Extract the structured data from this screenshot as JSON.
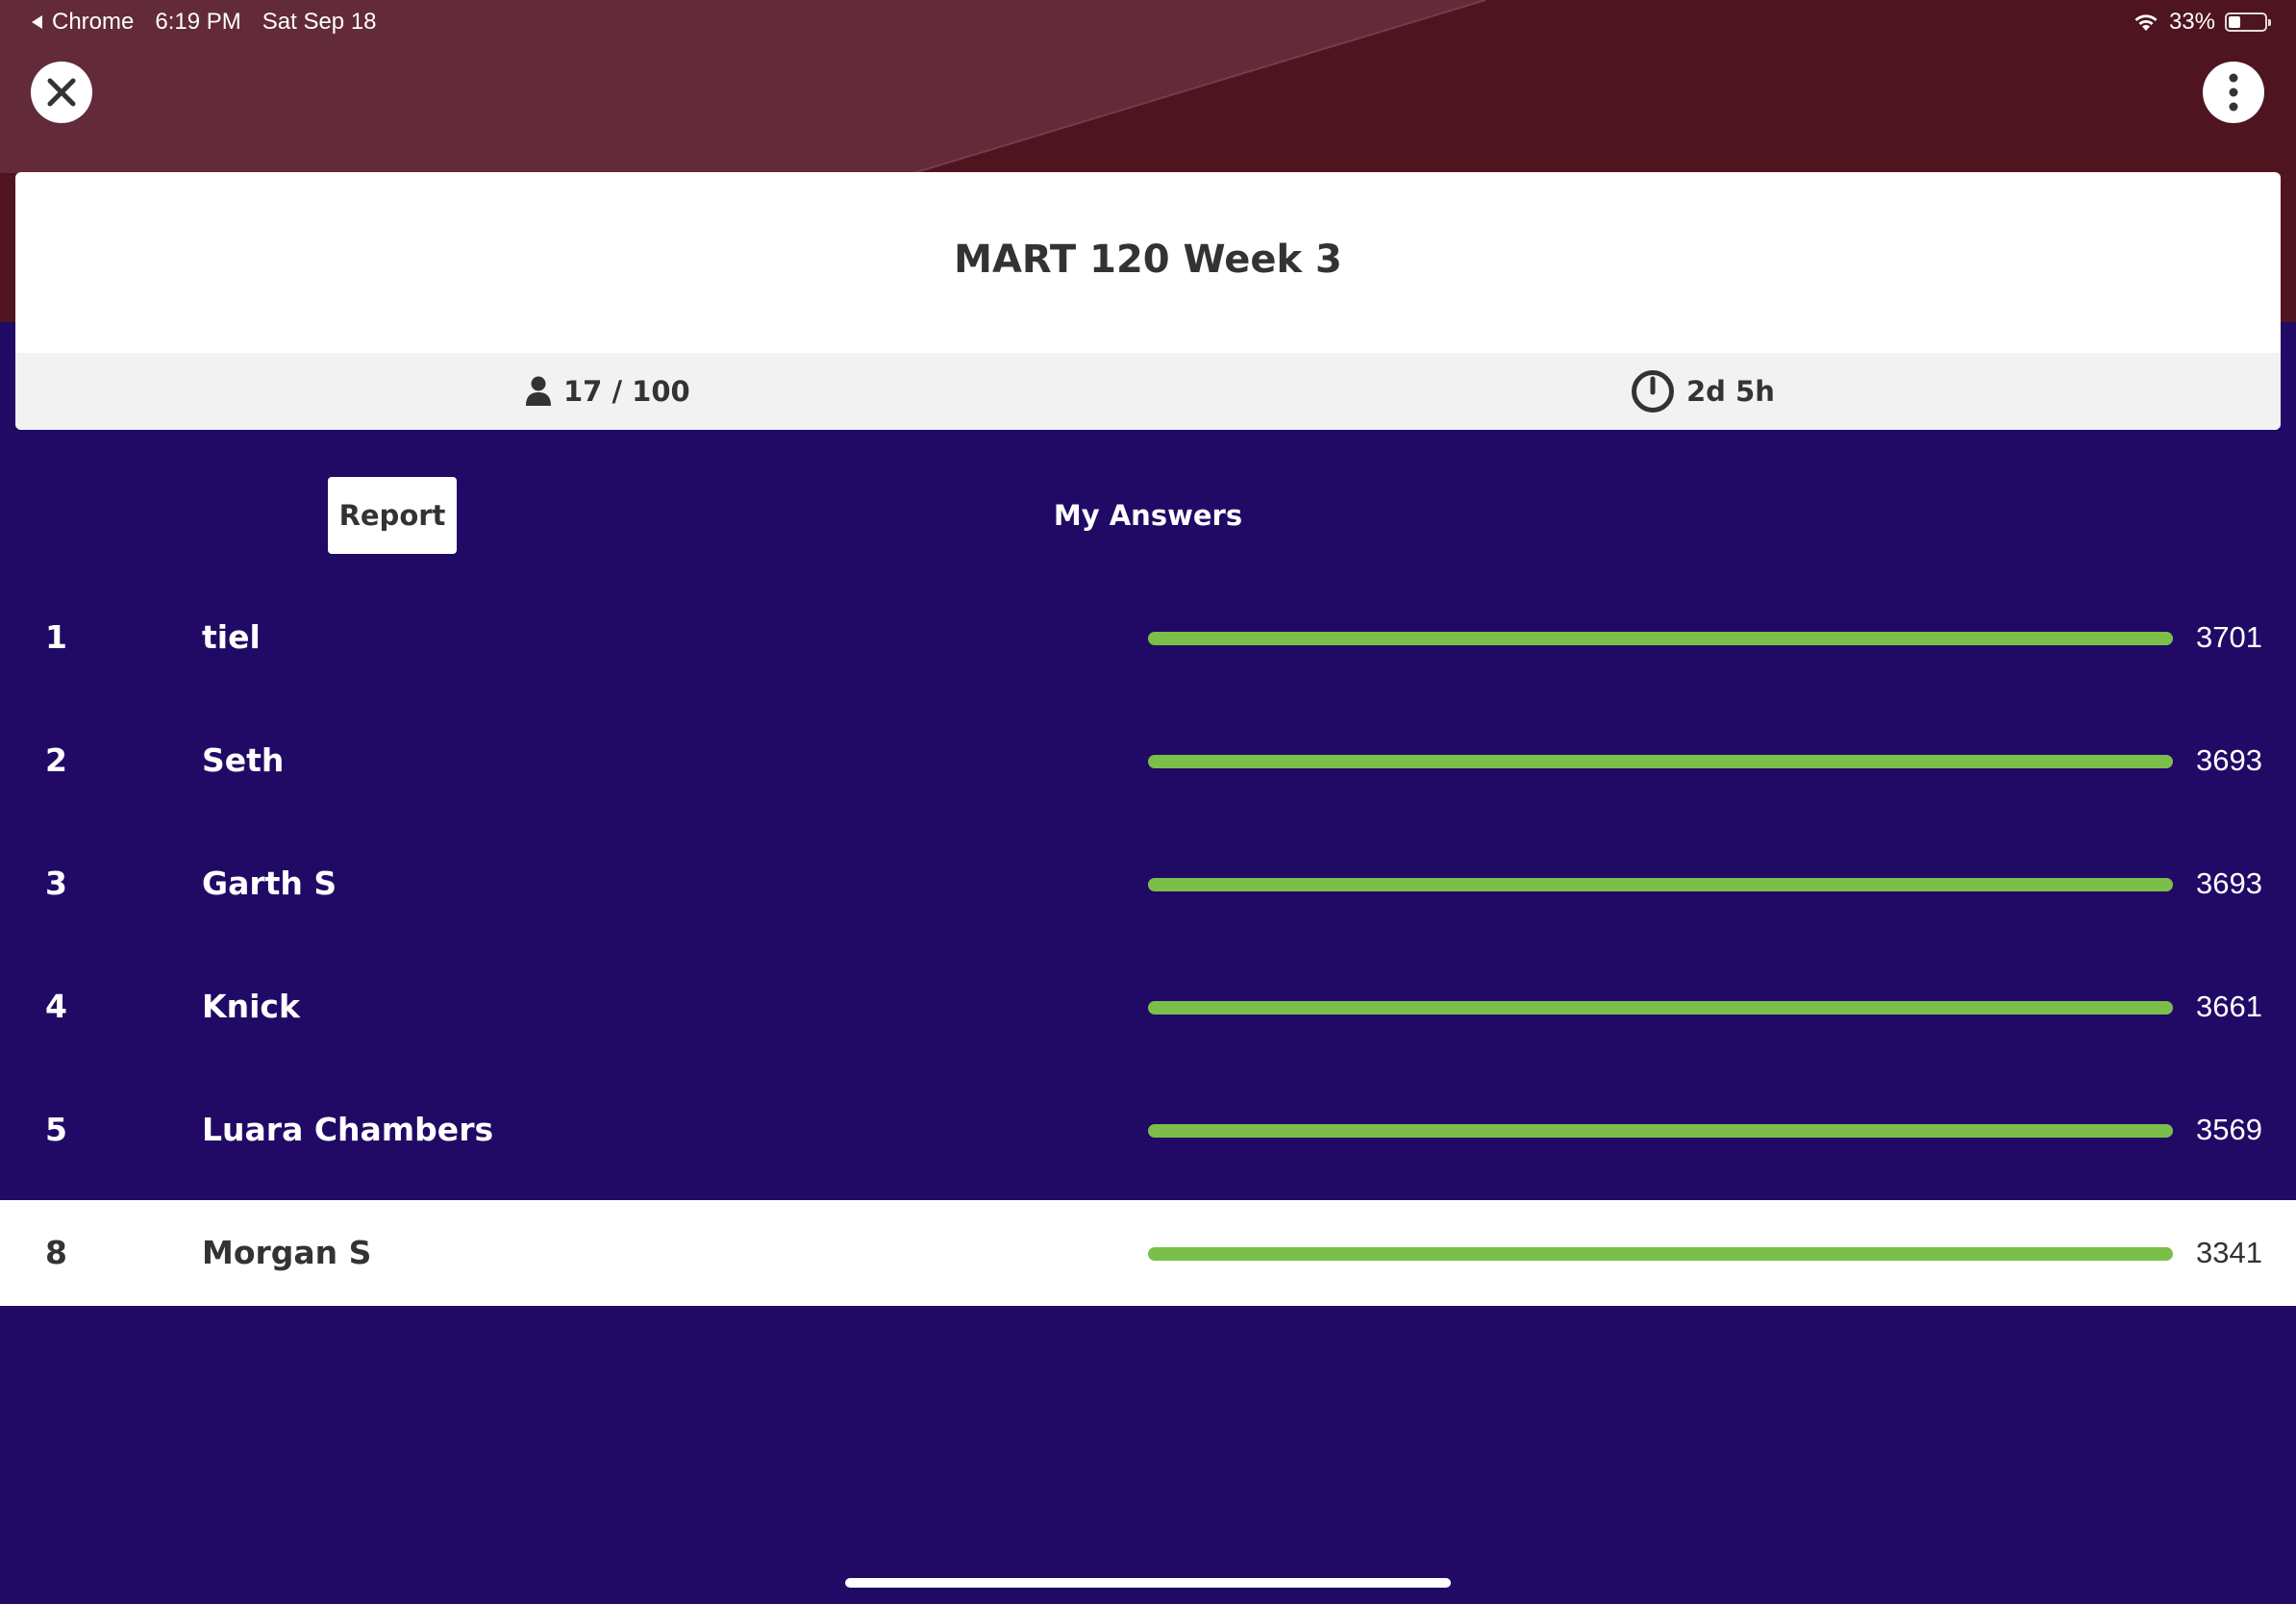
{
  "status_bar": {
    "back_app": "Chrome",
    "time": "6:19 PM",
    "date": "Sat Sep 18",
    "battery": "33%",
    "battery_level": 0.33
  },
  "quiz": {
    "title": "MART 120 Week 3",
    "players": "17 / 100",
    "time_left": "2d 5h"
  },
  "tabs": {
    "report": "Report",
    "my_answers": "My Answers"
  },
  "leaderboard": [
    {
      "rank": "1",
      "name": "tiel",
      "score": "3701",
      "bar_fraction": 1.0
    },
    {
      "rank": "2",
      "name": "Seth",
      "score": "3693",
      "bar_fraction": 1.0
    },
    {
      "rank": "3",
      "name": "Garth S",
      "score": "3693",
      "bar_fraction": 1.0
    },
    {
      "rank": "4",
      "name": "Knick",
      "score": "3661",
      "bar_fraction": 1.0
    },
    {
      "rank": "5",
      "name": "Luara Chambers",
      "score": "3569",
      "bar_fraction": 1.0
    },
    {
      "rank": "8",
      "name": "Morgan S",
      "score": "3341",
      "bar_fraction": 1.0
    }
  ],
  "colors": {
    "header_bg": "#4e1520",
    "page_bg": "#200a66",
    "bar": "#7bbf4a"
  },
  "icons": {
    "close": "close-icon",
    "menu": "more-vertical-icon",
    "players": "person-icon",
    "timer": "timer-icon"
  }
}
